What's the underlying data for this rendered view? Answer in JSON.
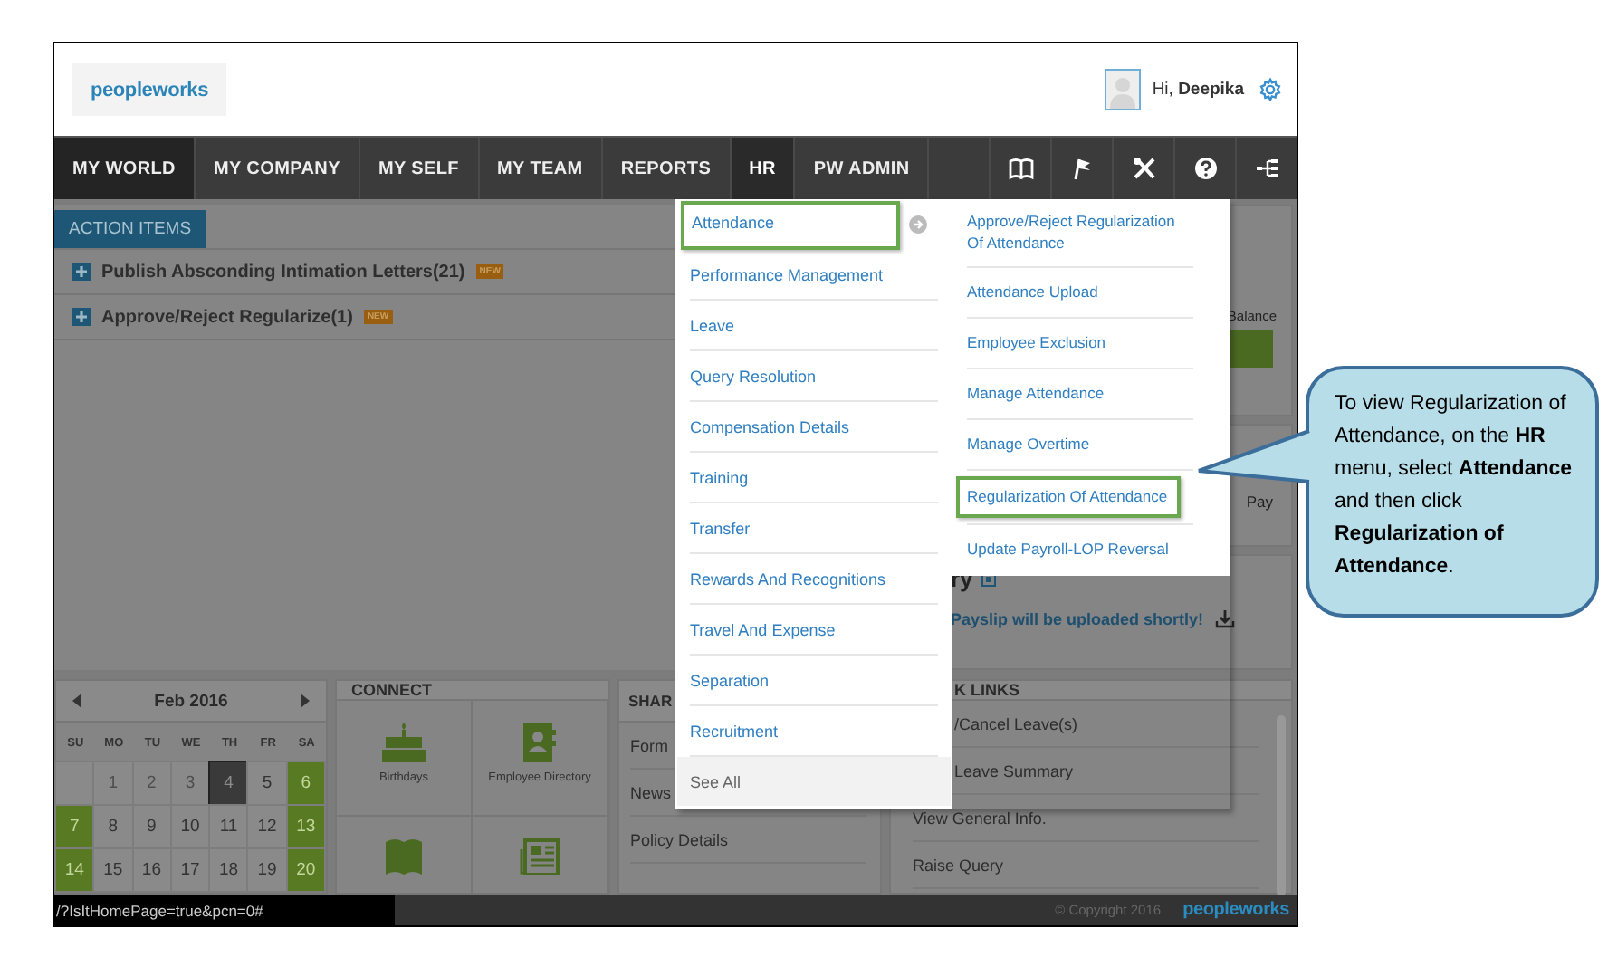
{
  "header": {
    "logo": "peopleworks",
    "greeting": "Hi, **Deepika**"
  },
  "nav": {
    "items": [
      {
        "label": "MY WORLD",
        "selected": true,
        "expanded": false
      },
      {
        "label": "MY COMPANY",
        "selected": false,
        "expanded": false
      },
      {
        "label": "MY SELF",
        "selected": false,
        "expanded": false
      },
      {
        "label": "MY TEAM",
        "selected": false,
        "expanded": false
      },
      {
        "label": "REPORTS",
        "selected": false,
        "expanded": false
      },
      {
        "label": "HR",
        "selected": false,
        "expanded": true
      },
      {
        "label": "PW ADMIN",
        "selected": false,
        "expanded": false
      }
    ]
  },
  "action_items": {
    "tab": "ACTION ITEMS",
    "rows": [
      {
        "label": "Publish Absconding Intimation Letters(21)",
        "badge": "NEW"
      },
      {
        "label": "Approve/Reject Regularize(1)",
        "badge": "NEW"
      }
    ]
  },
  "widgets": {
    "balance_label": "Balance",
    "pay_label": "Pay",
    "panel_title": "ry",
    "payslip_message": "Payslip will be uploaded shortly!"
  },
  "calendar": {
    "month": "Feb 2016",
    "weekdays": [
      "SU",
      "MO",
      "TU",
      "WE",
      "TH",
      "FR",
      "SA"
    ],
    "days": [
      {
        "kind": "blank"
      },
      {
        "label": "1",
        "kind": "muted"
      },
      {
        "label": "2",
        "kind": "muted"
      },
      {
        "label": "3",
        "kind": "muted"
      },
      {
        "label": "4",
        "kind": "today"
      },
      {
        "label": "5",
        "kind": "plain"
      },
      {
        "label": "6",
        "kind": "weekend"
      },
      {
        "label": "7",
        "kind": "weekend"
      },
      {
        "label": "8",
        "kind": "plain"
      },
      {
        "label": "9",
        "kind": "plain"
      },
      {
        "label": "10",
        "kind": "plain"
      },
      {
        "label": "11",
        "kind": "plain"
      },
      {
        "label": "12",
        "kind": "plain"
      },
      {
        "label": "13",
        "kind": "weekend"
      },
      {
        "label": "14",
        "kind": "weekend"
      },
      {
        "label": "15",
        "kind": "plain"
      },
      {
        "label": "16",
        "kind": "plain"
      },
      {
        "label": "17",
        "kind": "plain"
      },
      {
        "label": "18",
        "kind": "plain"
      },
      {
        "label": "19",
        "kind": "plain"
      },
      {
        "label": "20",
        "kind": "weekend"
      }
    ]
  },
  "connect": {
    "title": "CONNECT",
    "tiles": [
      {
        "label": "Birthdays"
      },
      {
        "label": "Employee Directory"
      }
    ]
  },
  "share": {
    "title": "SHAR",
    "items": [
      "Form",
      "News",
      "Policy Details"
    ]
  },
  "quick_links": {
    "title": "K LINKS",
    "items": [
      "/Cancel Leave(s)",
      "Leave Summary",
      "View General Info.",
      "Raise Query"
    ]
  },
  "status_url": "/?IsItHomePage=true&pcn=0#",
  "footer": {
    "copyright": "© Copyright 2016",
    "logo": "peopleworks"
  },
  "hr_menu": {
    "items": [
      {
        "label": "Attendance",
        "selected": true,
        "kind": "link"
      },
      {
        "label": "Performance Management",
        "selected": false,
        "kind": "link"
      },
      {
        "label": "Leave",
        "selected": false,
        "kind": "link"
      },
      {
        "label": "Query Resolution",
        "selected": false,
        "kind": "link"
      },
      {
        "label": "Compensation Details",
        "selected": false,
        "kind": "link"
      },
      {
        "label": "Training",
        "selected": false,
        "kind": "link"
      },
      {
        "label": "Transfer",
        "selected": false,
        "kind": "link"
      },
      {
        "label": "Rewards And Recognitions",
        "selected": false,
        "kind": "link"
      },
      {
        "label": "Travel And Expense",
        "selected": false,
        "kind": "link"
      },
      {
        "label": "Separation",
        "selected": false,
        "kind": "link"
      },
      {
        "label": "Recruitment",
        "selected": false,
        "kind": "link"
      },
      {
        "label": "See All",
        "selected": false,
        "kind": "see_all"
      }
    ],
    "submenu": [
      {
        "label": "Approve/Reject Regularization Of Attendance",
        "selected": false
      },
      {
        "label": "Attendance Upload",
        "selected": false
      },
      {
        "label": "Employee Exclusion",
        "selected": false
      },
      {
        "label": "Manage Attendance",
        "selected": false
      },
      {
        "label": "Manage Overtime",
        "selected": false
      },
      {
        "label": "Regularization Of Attendance",
        "selected": true
      },
      {
        "label": "Update Payroll-LOP Reversal",
        "selected": false
      }
    ]
  },
  "callout": {
    "text": "To view Regularization of Attendance, on the **HR** menu, select **Attendance** and then click **Regularization of Attendance**."
  }
}
